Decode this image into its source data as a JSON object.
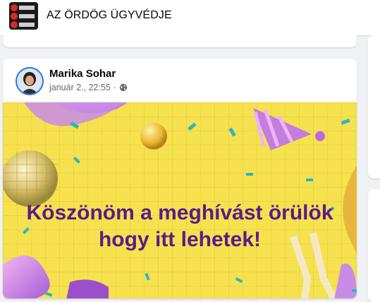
{
  "group": {
    "title": "AZ ÖRDÖG ÜGYVÉDJE"
  },
  "post": {
    "author": "Marika Sohar",
    "date": "január 2., 22:55",
    "separator": "·",
    "privacy_icon": "globe-icon",
    "image": {
      "caption_line1": "Köszönöm a meghívást örülök",
      "caption_line2": "hogy itt lehetek!",
      "background": "#f6e24f",
      "text_color": "#5b1a8a"
    }
  },
  "colors": {
    "accent": "#1877f2",
    "page_bg": "#f0f2f5",
    "meta_text": "#65676b"
  }
}
